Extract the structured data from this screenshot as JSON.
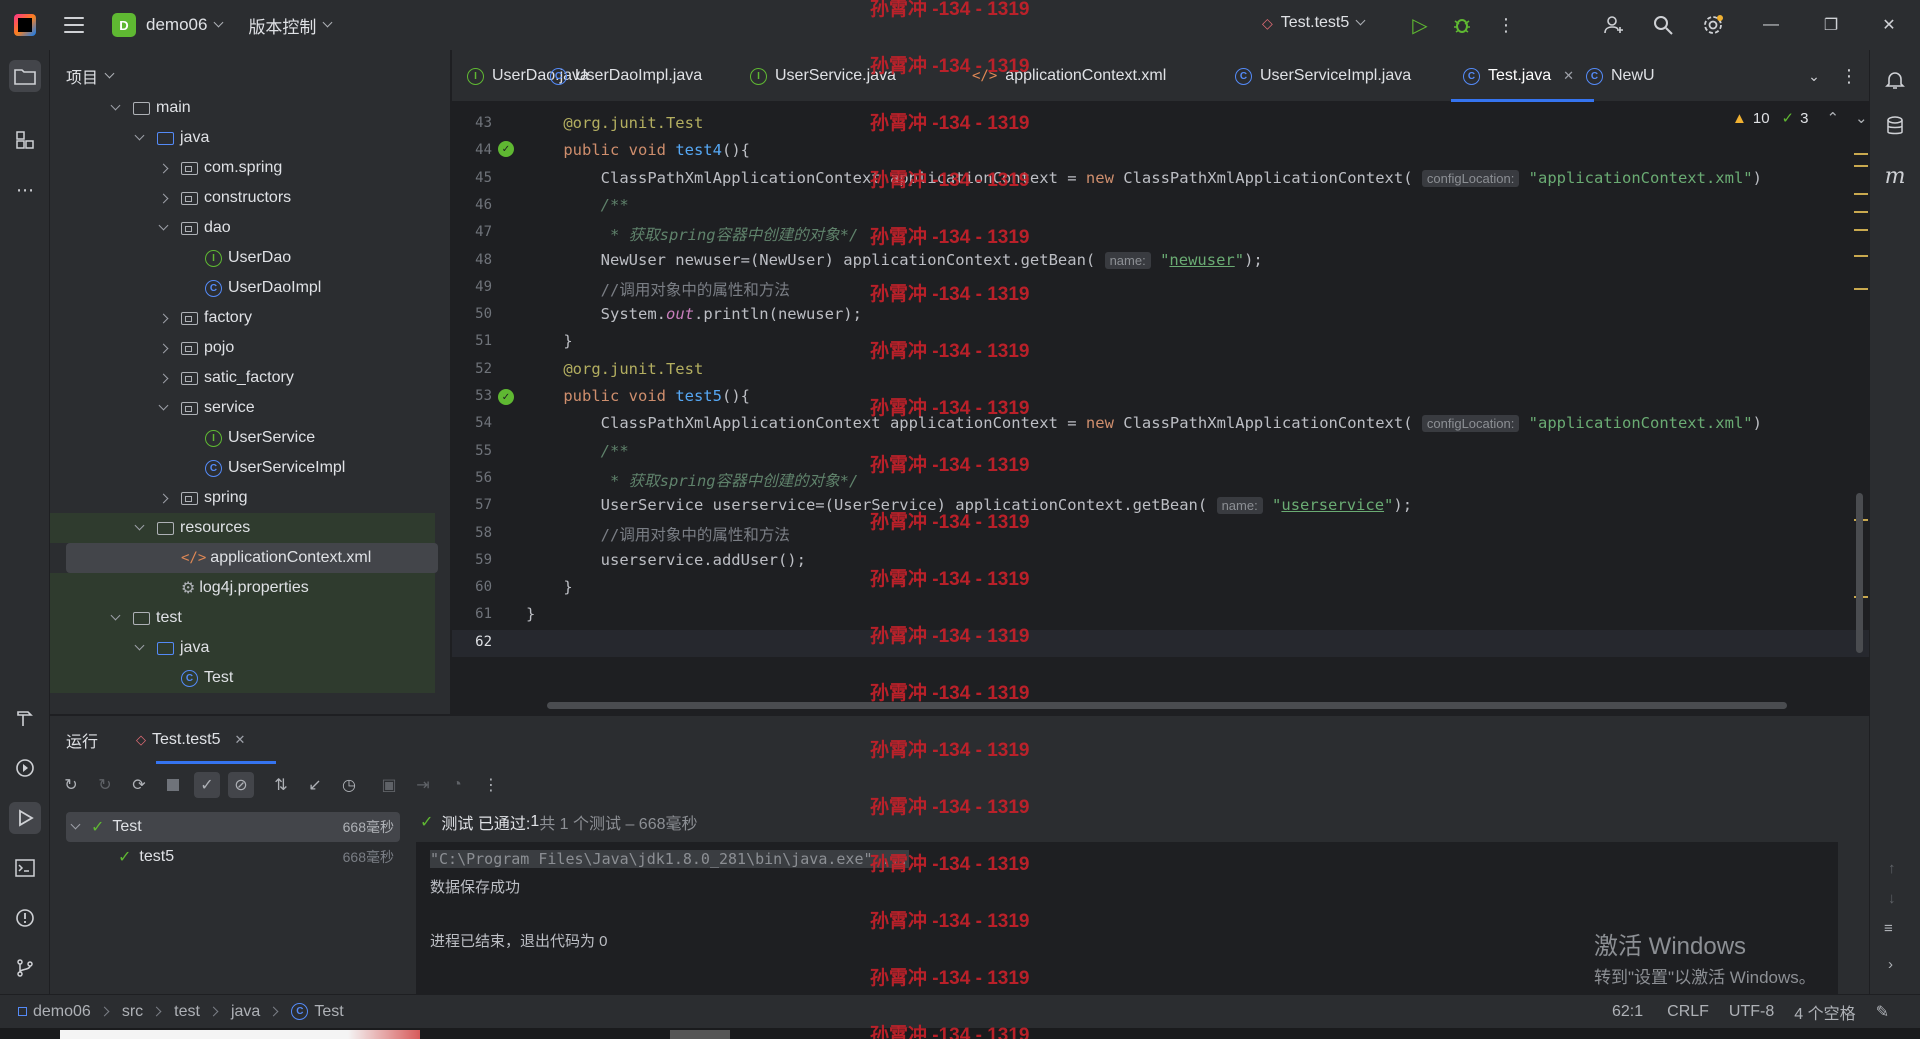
{
  "titlebar": {
    "project_badge": "D",
    "project_name": "demo06",
    "vcs_label": "版本控制",
    "run_config": "Test.test5"
  },
  "project_panel": {
    "title": "项目",
    "tree": [
      {
        "label": "main",
        "kind": "folder",
        "indent": 1,
        "expanded": true
      },
      {
        "label": "java",
        "kind": "folder-src",
        "indent": 2,
        "expanded": true
      },
      {
        "label": "com.spring",
        "kind": "package",
        "indent": 3,
        "expanded": false
      },
      {
        "label": "constructors",
        "kind": "package",
        "indent": 3,
        "expanded": false
      },
      {
        "label": "dao",
        "kind": "package",
        "indent": 3,
        "expanded": true
      },
      {
        "label": "UserDao",
        "kind": "interface",
        "indent": 4
      },
      {
        "label": "UserDaoImpl",
        "kind": "class",
        "indent": 4
      },
      {
        "label": "factory",
        "kind": "package",
        "indent": 3,
        "expanded": false
      },
      {
        "label": "pojo",
        "kind": "package",
        "indent": 3,
        "expanded": false
      },
      {
        "label": "satic_factory",
        "kind": "package",
        "indent": 3,
        "expanded": false
      },
      {
        "label": "service",
        "kind": "package",
        "indent": 3,
        "expanded": true
      },
      {
        "label": "UserService",
        "kind": "interface",
        "indent": 4
      },
      {
        "label": "UserServiceImpl",
        "kind": "class",
        "indent": 4
      },
      {
        "label": "spring",
        "kind": "package",
        "indent": 3,
        "expanded": false
      },
      {
        "label": "resources",
        "kind": "folder",
        "indent": 2,
        "expanded": true
      },
      {
        "label": "applicationContext.xml",
        "kind": "xml",
        "indent": 3
      },
      {
        "label": "log4j.properties",
        "kind": "props",
        "indent": 3
      },
      {
        "label": "test",
        "kind": "folder",
        "indent": 1,
        "expanded": true
      },
      {
        "label": "java",
        "kind": "folder-src",
        "indent": 2,
        "expanded": true
      },
      {
        "label": "Test",
        "kind": "class",
        "indent": 3
      }
    ]
  },
  "tabs": [
    {
      "label": "UserDao.java",
      "icon": "interface"
    },
    {
      "label": "UserDaoImpl.java",
      "icon": "class"
    },
    {
      "label": "UserService.java",
      "icon": "interface"
    },
    {
      "label": "applicationContext.xml",
      "icon": "xml"
    },
    {
      "label": "UserServiceImpl.java",
      "icon": "class"
    },
    {
      "label": "Test.java",
      "icon": "class",
      "active": true
    },
    {
      "label": "NewU",
      "icon": "class"
    }
  ],
  "editor": {
    "warnings": "10",
    "weak_warnings": "3",
    "line_numbers": [
      "43",
      "44",
      "45",
      "46",
      "47",
      "48",
      "49",
      "50",
      "51",
      "52",
      "53",
      "54",
      "55",
      "56",
      "57",
      "58",
      "59",
      "60",
      "61",
      "62"
    ],
    "hints": {
      "config_location": "configLocation:",
      "name": "name:"
    },
    "strings": {
      "app_ctx": "\"applicationContext.xml\"",
      "newuser": "newuser",
      "userservice": "userservice"
    },
    "comments": {
      "doc_open": "/**",
      "doc_get": " * 获取spring容器中创建的对象*/",
      "call_comment": "//调用对象中的属性和方法"
    }
  },
  "run_panel": {
    "title": "运行",
    "tab_label": "Test.test5",
    "status_prefix": "测试 已通过: ",
    "status_count": "1",
    "status_suffix": "共 1 个测试 – 668毫秒",
    "tests": [
      {
        "name": "Test",
        "time": "668毫秒"
      },
      {
        "name": "test5",
        "time": "668毫秒"
      }
    ],
    "console": [
      "\"C:\\Program Files\\Java\\jdk1.8.0_281\\bin\\java.exe\" ...",
      "数据保存成功",
      "",
      "进程已结束，退出代码为 0"
    ]
  },
  "windows_watermark": {
    "line1": "激活 Windows",
    "line2": "转到\"设置\"以激活 Windows。"
  },
  "statusbar": {
    "breadcrumbs": [
      "demo06",
      "src",
      "test",
      "java",
      "Test"
    ],
    "position": "62:1",
    "line_ending": "CRLF",
    "encoding": "UTF-8",
    "indent": "4 个空格"
  },
  "overlay_watermark": "孙霄冲 -134 - 1319",
  "colors": {
    "accent": "#3574f0",
    "success": "#5fb832",
    "watermark": "#c7212a"
  }
}
